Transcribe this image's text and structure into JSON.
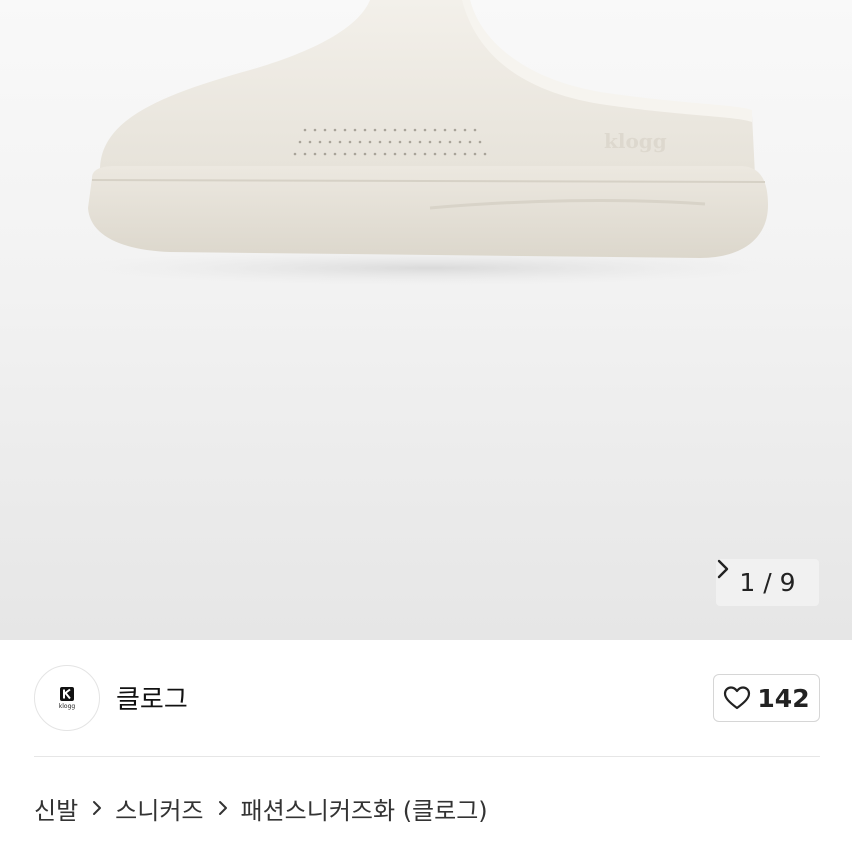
{
  "gallery": {
    "current": "1",
    "separator": "/",
    "total": "9",
    "product_emboss": "klogg"
  },
  "brand": {
    "logo_text": "klogg",
    "name": "클로그",
    "like_count": "142"
  },
  "breadcrumb": {
    "items": [
      "신발",
      "스니커즈",
      "패션스니커즈화 (클로그)"
    ]
  },
  "icons": {
    "next": "chevron-right-icon",
    "like": "heart-outline-icon",
    "separator": "chevron-right-icon"
  },
  "colors": {
    "product": "#ebe7df",
    "background": "#f2f2f2"
  }
}
